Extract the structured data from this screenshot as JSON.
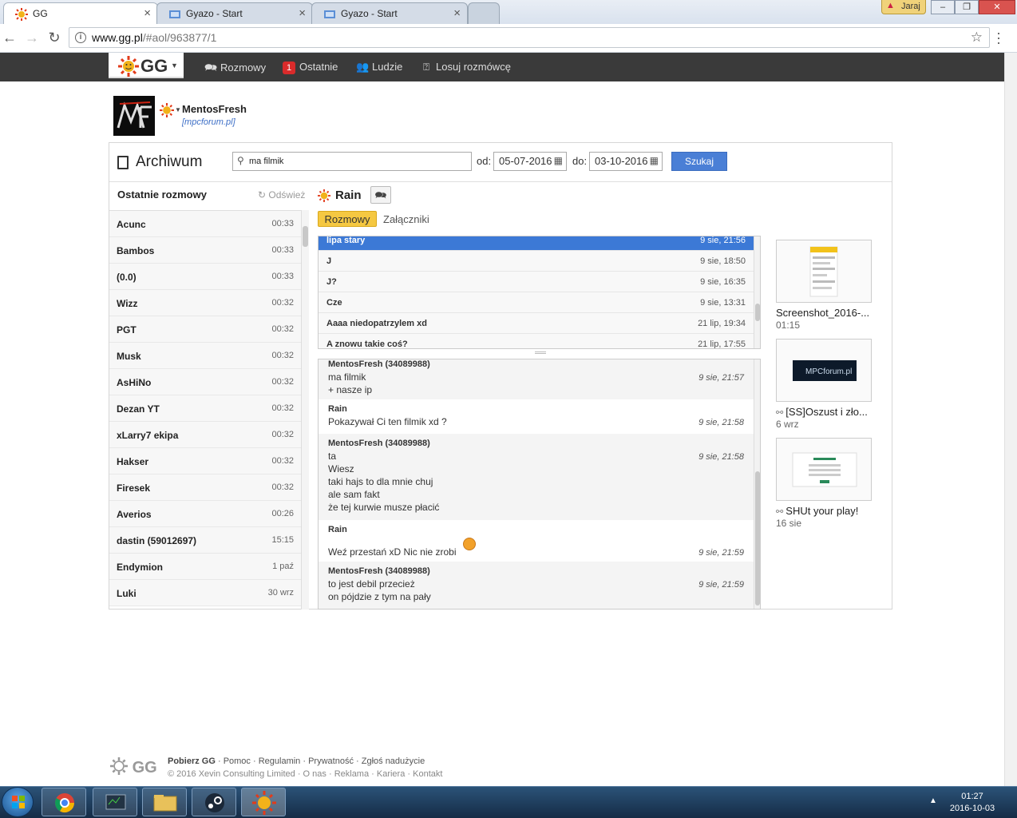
{
  "browser": {
    "tabs": [
      {
        "title": "GG"
      },
      {
        "title": "Gyazo - Start"
      },
      {
        "title": "Gyazo - Start"
      }
    ],
    "user_badge": "Jaraj",
    "url_host": "www.gg.pl",
    "url_path": "/#aol/963877/1"
  },
  "nav": {
    "logo": "GG",
    "items": [
      {
        "label": "Rozmowy"
      },
      {
        "label": "Ostatnie",
        "badge": "1"
      },
      {
        "label": "Ludzie"
      },
      {
        "label": "Losuj rozmówcę"
      }
    ]
  },
  "profile": {
    "name": "MentosFresh",
    "description": "[mpcforum.pl]"
  },
  "archive": {
    "title": "Archiwum",
    "search_value": "ma filmik",
    "from_label": "od:",
    "from_date": "05-07-2016",
    "to_label": "do:",
    "to_date": "03-10-2016",
    "search_button": "Szukaj"
  },
  "recent": {
    "header": "Ostatnie rozmowy",
    "refresh": "Odśwież",
    "items": [
      {
        "name": "Acunc",
        "time": "00:33"
      },
      {
        "name": "Bambos",
        "time": "00:33"
      },
      {
        "name": "(0.0)",
        "time": "00:33"
      },
      {
        "name": "Wizz",
        "time": "00:32"
      },
      {
        "name": "PGT",
        "time": "00:32"
      },
      {
        "name": "Musk",
        "time": "00:32"
      },
      {
        "name": "AsHiNo",
        "time": "00:32"
      },
      {
        "name": "Dezan YT",
        "time": "00:32"
      },
      {
        "name": "xLarry7 ekipa",
        "time": "00:32"
      },
      {
        "name": "Hakser",
        "time": "00:32"
      },
      {
        "name": "Firesek",
        "time": "00:32"
      },
      {
        "name": "Averios",
        "time": "00:26"
      },
      {
        "name": "dastin (59012697)",
        "time": "15:15"
      },
      {
        "name": "Endymion",
        "time": "1 paź"
      },
      {
        "name": "Luki",
        "time": "30 wrz"
      }
    ]
  },
  "conversation": {
    "contact": "Rain",
    "tab_active": "Rozmowy",
    "tab_other": "Załączniki",
    "threads": [
      {
        "title": "lipa stary",
        "time": "9 sie, 21:56",
        "selected": true
      },
      {
        "title": "J",
        "time": "9 sie, 18:50"
      },
      {
        "title": "J?",
        "time": "9 sie, 16:35"
      },
      {
        "title": "Cze",
        "time": "9 sie, 13:31"
      },
      {
        "title": "Aaaa niedopatrzylem xd",
        "time": "21 lip, 19:34"
      },
      {
        "title": "A znowu takie coś?",
        "time": "21 lip, 17:55"
      }
    ],
    "messages": [
      {
        "author": "MentosFresh (34089988)",
        "lines": [
          "ma filmik",
          "+ nasze ip"
        ],
        "time": "9 sie, 21:57"
      },
      {
        "author": "Rain",
        "lines": [
          "Pokazywał Ci ten filmik xd ?"
        ],
        "time": "9 sie, 21:58"
      },
      {
        "author": "MentosFresh (34089988)",
        "lines": [
          "ta",
          "Wiesz",
          "taki hajs to dla mnie chuj",
          "ale sam fakt",
          "że tej kurwie musze płacić"
        ],
        "time": "9 sie, 21:58"
      },
      {
        "author": "Rain",
        "lines": [
          "Weź przestań xD Nic nie zrobi"
        ],
        "time": "9 sie, 21:59"
      },
      {
        "author": "MentosFresh (34089988)",
        "lines": [
          "to jest debil przecież",
          "on pójdzie z tym na pały"
        ],
        "time": "9 sie, 21:59"
      }
    ]
  },
  "attachments": [
    {
      "caption": "Screenshot_2016-...",
      "sub": "01:15"
    },
    {
      "caption": "[SS]Oszust i zło...",
      "sub": "6 wrz",
      "thumb_text": "MPCforum.pl"
    },
    {
      "caption": "SHUt your play!",
      "sub": "16 sie"
    }
  ],
  "footer": {
    "logo": "GG",
    "links": [
      "Pobierz GG",
      "Pomoc",
      "Regulamin",
      "Prywatność",
      "Zgłoś nadużycie"
    ],
    "copyright": "© 2016 Xevin Consulting Limited",
    "links2": [
      "O nas",
      "Reklama",
      "Kariera",
      "Kontakt"
    ]
  },
  "taskbar": {
    "time": "01:27",
    "date": "2016-10-03"
  },
  "colors": {
    "accent": "#3c79d6",
    "nav_bg": "#3a3a3a",
    "tab_active": "#f5c842",
    "badge": "#d92b2b"
  }
}
